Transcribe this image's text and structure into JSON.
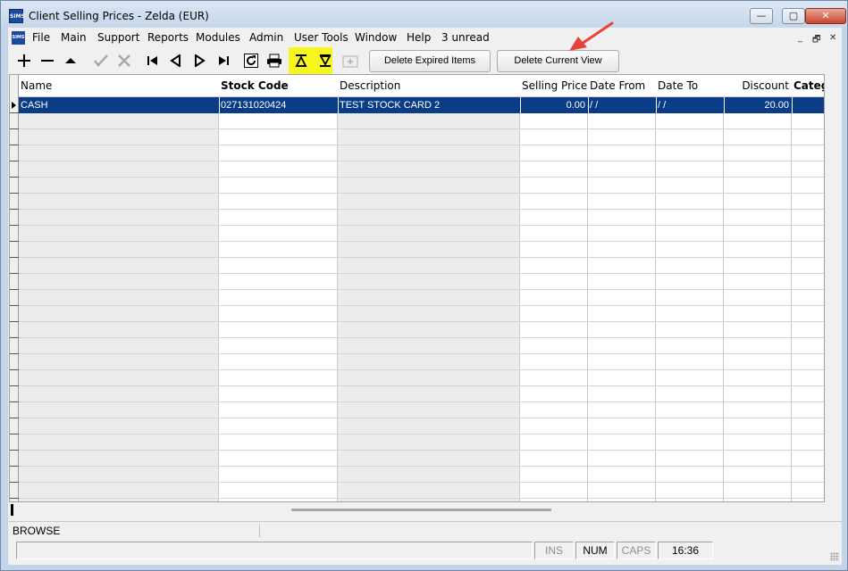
{
  "window": {
    "title": "Client Selling Prices - Zelda (EUR)",
    "app_icon_text": "SIMS",
    "minimize": "—",
    "maximize": "▢",
    "close": "✕"
  },
  "menu": {
    "icon_text": "SIMS",
    "items": [
      "File",
      "Main",
      "Support",
      "Reports",
      "Modules",
      "Admin",
      "User Tools",
      "Window",
      "Help",
      "3 unread"
    ],
    "mdi_minimize": "_",
    "mdi_restore": "🗗",
    "mdi_close": "✕"
  },
  "toolbar": {
    "delete_expired_label": "Delete Expired Items",
    "delete_view_label": "Delete Current View",
    "highlight_color": "#f7f71d"
  },
  "grid": {
    "columns": [
      "Name",
      "Stock Code",
      "Description",
      "Selling Price",
      "Date From",
      "Date To",
      "Discount",
      "Categ"
    ],
    "rows": [
      {
        "name": "CASH",
        "stock_code": "027131020424",
        "description": "TEST STOCK CARD 2",
        "selling_price": "0.00",
        "date_from": "/  /",
        "date_to": "/  /",
        "discount": "20.00",
        "category": ""
      }
    ],
    "selection_color": "#0a3d86"
  },
  "status": {
    "mode": "BROWSE",
    "ins": "INS",
    "num": "NUM",
    "caps": "CAPS",
    "time": "16:36"
  },
  "annotation_color": "#e8413a"
}
